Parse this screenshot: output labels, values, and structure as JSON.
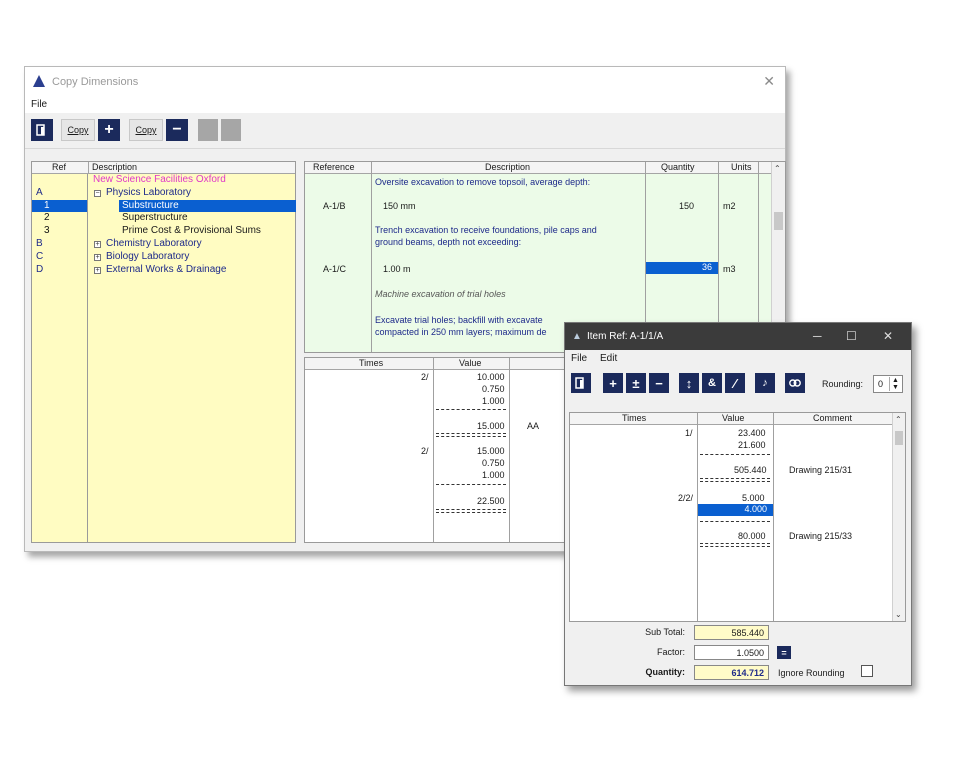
{
  "main_window": {
    "title": "Copy Dimensions",
    "close_glyph": "✕",
    "menu": [
      "File"
    ],
    "toolbar": {
      "copy_plus_label": "Copy",
      "copy_minus_label": "Copy"
    }
  },
  "tree": {
    "headers": {
      "ref": "Ref",
      "description": "Description"
    },
    "refs": [
      "A",
      "1",
      "2",
      "3",
      "B",
      "C",
      "D"
    ],
    "items": [
      {
        "label": "New Science Facilities Oxford",
        "color": "#e038c8"
      },
      {
        "label": "Physics Laboratory",
        "expander": "−"
      },
      {
        "label": "Substructure",
        "selected": true
      },
      {
        "label": "Superstructure"
      },
      {
        "label": "Prime Cost & Provisional Sums"
      },
      {
        "label": "Chemistry Laboratory",
        "expander": "+"
      },
      {
        "label": "Biology Laboratory",
        "expander": "+"
      },
      {
        "label": "External Works & Drainage",
        "expander": "+"
      }
    ]
  },
  "ref_table": {
    "headers": {
      "reference": "Reference",
      "description": "Description",
      "quantity": "Quantity",
      "units": "Units"
    },
    "rows": [
      {
        "description": "Oversite excavation to remove topsoil, average depth:"
      },
      {
        "reference": "A-1/B",
        "description": "150 mm",
        "quantity": "150",
        "units": "m2"
      },
      {
        "description": "Trench excavation to receive foundations, pile caps and"
      },
      {
        "description": "ground beams, depth not exceeding:"
      },
      {
        "reference": "A-1/C",
        "description": "1.00 m",
        "quantity": "36",
        "units": "m3"
      },
      {
        "description": "Machine excavation of trial holes"
      },
      {
        "description": "Excavate trial holes; backfill with excavate"
      },
      {
        "description": "compacted in 250 mm layers; maximum de"
      }
    ]
  },
  "times_table": {
    "headers": {
      "times": "Times",
      "value": "Value"
    },
    "rows": [
      {
        "times": "2/",
        "value": "10.000"
      },
      {
        "value": "0.750"
      },
      {
        "value": "1.000"
      },
      {
        "value": "15.000",
        "code": "AA"
      },
      {
        "times": "2/",
        "value": "15.000"
      },
      {
        "value": "0.750"
      },
      {
        "value": "1.000"
      },
      {
        "value": "22.500"
      }
    ]
  },
  "dialog": {
    "title": "Item Ref: A-1/1/A",
    "window_controls": {
      "minimize": "─",
      "maximize": "☐",
      "close": "✕"
    },
    "menu": [
      "File",
      "Edit"
    ],
    "toolbar_icons": [
      "exit-icon",
      "plus-icon",
      "plus-minus-icon",
      "minus-icon",
      "up-down-icon",
      "ampersand-icon",
      "slash-icon",
      "music-note-icon",
      "link-icon"
    ],
    "rounding_label": "Rounding:",
    "rounding_value": "0",
    "grid": {
      "headers": {
        "times": "Times",
        "value": "Value",
        "comment": "Comment"
      },
      "rows": [
        {
          "times": "1/",
          "value": "23.400"
        },
        {
          "value": "21.600"
        },
        {
          "value": "505.440",
          "comment": "Drawing 215/31"
        },
        {
          "times": "2/2/",
          "value": "5.000"
        },
        {
          "value": "4.000",
          "selected": true
        },
        {
          "value": "80.000",
          "comment": "Drawing 215/33"
        }
      ]
    },
    "footer": {
      "subtotal_label": "Sub Total:",
      "subtotal_value": "585.440",
      "factor_label": "Factor:",
      "factor_value": "1.0500",
      "quantity_label": "Quantity:",
      "quantity_value": "614.712",
      "ignore_rounding_label": "Ignore Rounding"
    }
  }
}
